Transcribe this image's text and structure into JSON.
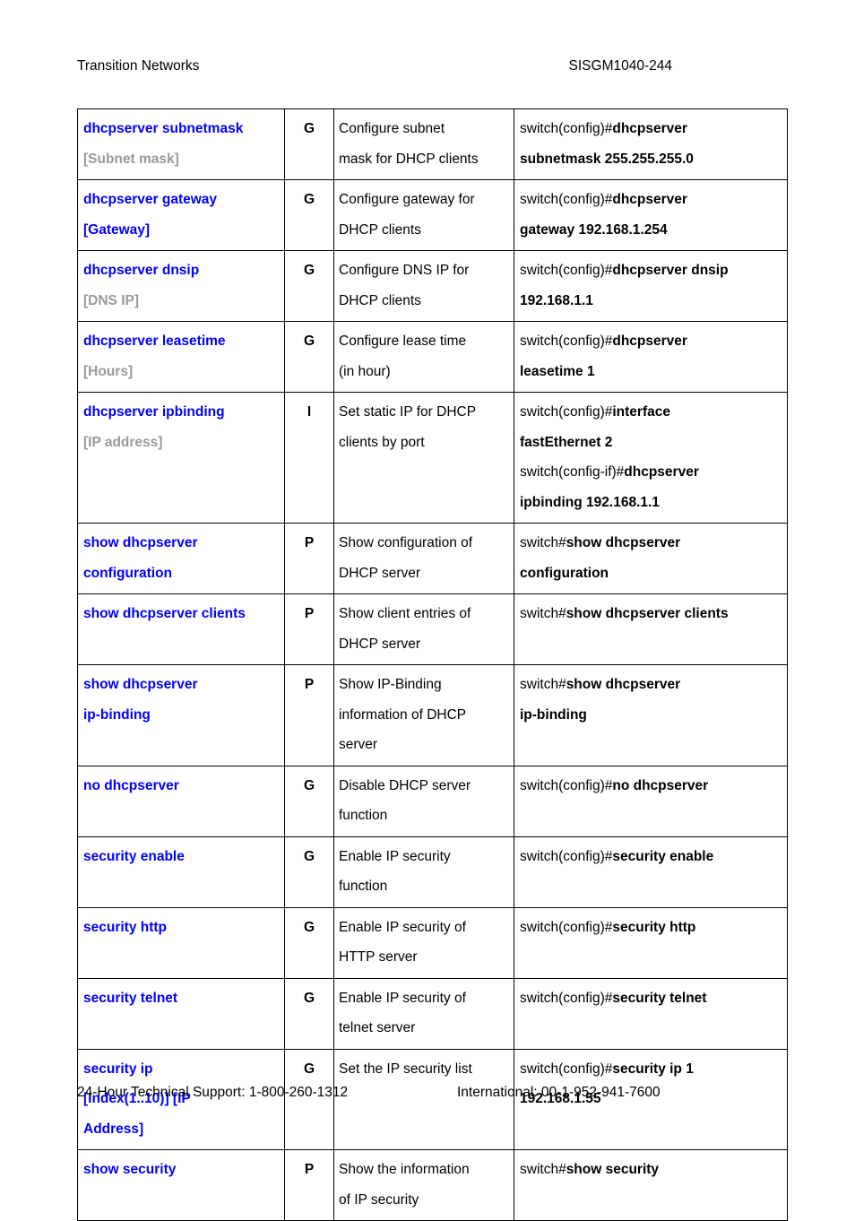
{
  "header": {
    "left": "Transition Networks",
    "right": "SISGM1040-244"
  },
  "footer": {
    "left": "24-Hour Technical Support: 1-800-260-1312",
    "right": "International: 00-1-952-941-7600"
  },
  "colors": {
    "command": "#0000ff",
    "argument_gray": "#999999",
    "argument_blue": "#0000ff",
    "text": "#000000",
    "border": "#000000"
  },
  "table": {
    "rows": [
      {
        "command": "dhcpserver subnetmask",
        "argument": "[Subnet mask]",
        "argument_style": "gray",
        "mode": "G",
        "description": [
          "Configure subnet",
          "mask for DHCP clients"
        ],
        "example": [
          {
            "prompt": "switch(config)#",
            "cmd": "dhcpserver"
          },
          {
            "prompt": "",
            "cmd": "subnetmask 255.255.255.0"
          }
        ]
      },
      {
        "command": "dhcpserver gateway",
        "argument": "[Gateway]",
        "argument_style": "blue",
        "mode": "G",
        "description": [
          "Configure gateway for",
          "DHCP clients"
        ],
        "example": [
          {
            "prompt": "switch(config)#",
            "cmd": "dhcpserver"
          },
          {
            "prompt": "",
            "cmd": "gateway 192.168.1.254"
          }
        ]
      },
      {
        "command": "dhcpserver dnsip",
        "argument": "[DNS IP]",
        "argument_style": "gray",
        "mode": "G",
        "description": [
          "Configure DNS IP for",
          "DHCP clients"
        ],
        "example": [
          {
            "prompt": "switch(config)#",
            "cmd": "dhcpserver dnsip"
          },
          {
            "prompt": "",
            "cmd": "192.168.1.1"
          }
        ]
      },
      {
        "command": "dhcpserver leasetime",
        "argument": "[Hours]",
        "argument_style": "gray",
        "mode": "G",
        "description": [
          "Configure lease time",
          "(in hour)"
        ],
        "example": [
          {
            "prompt": "switch(config)#",
            "cmd": "dhcpserver"
          },
          {
            "prompt": "",
            "cmd": "leasetime 1"
          }
        ]
      },
      {
        "command": "dhcpserver ipbinding",
        "argument": "[IP address]",
        "argument_style": "gray",
        "mode": "I",
        "description": [
          "Set static IP for DHCP",
          "clients by port"
        ],
        "example": [
          {
            "prompt": "switch(config)#",
            "cmd": "interface"
          },
          {
            "prompt": "",
            "cmd": "fastEthernet 2"
          },
          {
            "prompt": "switch(config-if)#",
            "cmd": "dhcpserver"
          },
          {
            "prompt": "",
            "cmd": "ipbinding 192.168.1.1"
          }
        ]
      },
      {
        "command": "show dhcpserver",
        "argument": "configuration",
        "argument_style": "blue",
        "mode": "P",
        "description": [
          "Show configuration of",
          "DHCP server"
        ],
        "example": [
          {
            "prompt": "switch#",
            "cmd": "show dhcpserver"
          },
          {
            "prompt": "",
            "cmd": "configuration"
          }
        ]
      },
      {
        "command": "show dhcpserver clients",
        "argument": "",
        "argument_style": "blue",
        "mode": "P",
        "description": [
          "Show client entries of",
          "DHCP server"
        ],
        "example": [
          {
            "prompt": "switch#",
            "cmd": "show dhcpserver clients"
          }
        ]
      },
      {
        "command": "show dhcpserver",
        "argument": "ip-binding",
        "argument_style": "blue",
        "mode": "P",
        "description": [
          "Show IP-Binding",
          "information of DHCP",
          "server"
        ],
        "example": [
          {
            "prompt": "switch#",
            "cmd": "show dhcpserver"
          },
          {
            "prompt": "",
            "cmd": "ip-binding"
          }
        ]
      },
      {
        "command": "no dhcpserver",
        "argument": "",
        "argument_style": "blue",
        "mode": "G",
        "description": [
          "Disable DHCP server",
          "function"
        ],
        "example": [
          {
            "prompt": "switch(config)#",
            "cmd": "no dhcpserver"
          }
        ]
      },
      {
        "command": "security enable",
        "argument": "",
        "argument_style": "blue",
        "mode": "G",
        "description": [
          "Enable IP security",
          "function"
        ],
        "example": [
          {
            "prompt": "switch(config)#",
            "cmd": "security enable"
          }
        ]
      },
      {
        "command": "security http",
        "argument": "",
        "argument_style": "blue",
        "mode": "G",
        "description": [
          "Enable IP security of",
          "HTTP server"
        ],
        "example": [
          {
            "prompt": "switch(config)#",
            "cmd": "security http"
          }
        ]
      },
      {
        "command": "security telnet",
        "argument": "",
        "argument_style": "blue",
        "mode": "G",
        "description": [
          "Enable IP security of",
          "telnet server"
        ],
        "example": [
          {
            "prompt": "switch(config)#",
            "cmd": "security telnet"
          }
        ]
      },
      {
        "command": "security ip",
        "argument": "[Index(1..10)] [IP\nAddress]",
        "argument_style": "blue",
        "mode": "G",
        "description": [
          "Set the IP security list"
        ],
        "example": [
          {
            "prompt": "switch(config)#",
            "cmd": "security ip 1"
          },
          {
            "prompt": "",
            "cmd": "192.168.1.55"
          }
        ]
      },
      {
        "command": "show security",
        "argument": "",
        "argument_style": "blue",
        "mode": "P",
        "description": [
          "Show the information",
          "of IP security"
        ],
        "example": [
          {
            "prompt": "switch#",
            "cmd": "show security"
          }
        ]
      }
    ]
  }
}
